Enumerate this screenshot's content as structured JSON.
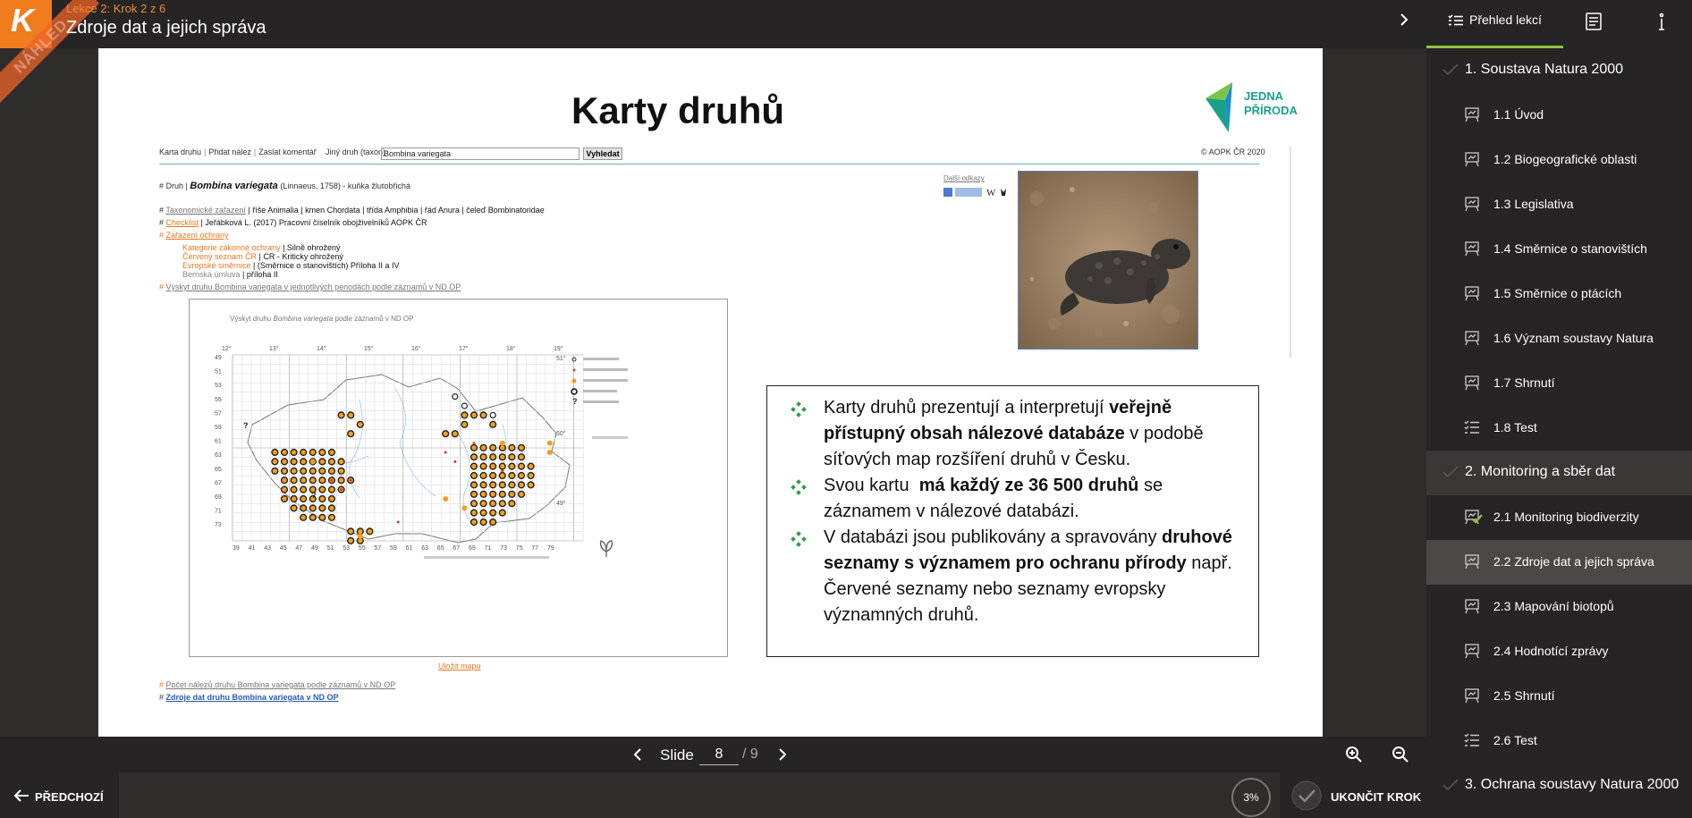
{
  "header": {
    "crumb": "Lekce 2: Krok 2 z 6",
    "title": "Zdroje dat a jejich správa",
    "logo_letter": "K",
    "ribbon": "NÁHLED"
  },
  "sidebar": {
    "tab_overview": "Přehled lekcí",
    "accent": "#8cc63f",
    "sections": [
      {
        "label": "1. Soustava Natura 2000",
        "items": [
          {
            "label": "1.1 Úvod",
            "icon": "slide-icon"
          },
          {
            "label": "1.2 Biogeografické oblasti",
            "icon": "slide-icon"
          },
          {
            "label": "1.3 Legislativa",
            "icon": "slide-icon"
          },
          {
            "label": "1.4 Směrnice o stanovištích",
            "icon": "slide-icon"
          },
          {
            "label": "1.5 Směrnice o ptácích",
            "icon": "slide-icon"
          },
          {
            "label": "1.6 Význam soustavy Natura",
            "icon": "slide-icon"
          },
          {
            "label": "1.7 Shrnutí",
            "icon": "slide-icon"
          },
          {
            "label": "1.8 Test",
            "icon": "test-icon"
          }
        ]
      },
      {
        "label": "2. Monitoring a sběr dat",
        "items": [
          {
            "label": "2.1 Monitoring biodiverzity",
            "icon": "slide-icon",
            "done": true
          },
          {
            "label": "2.2 Zdroje dat a jejich správa",
            "icon": "slide-icon",
            "active": true
          },
          {
            "label": "2.3 Mapování biotopů",
            "icon": "slide-icon"
          },
          {
            "label": "2.4 Hodnotící zprávy",
            "icon": "slide-icon"
          },
          {
            "label": "2.5 Shrnutí",
            "icon": "slide-icon"
          },
          {
            "label": "2.6 Test",
            "icon": "test-icon"
          }
        ]
      },
      {
        "label": "3. Ochrana soustavy Natura 2000",
        "items": []
      }
    ]
  },
  "slide": {
    "title": "Karty druhů",
    "brand_line1": "JEDNA",
    "brand_line2": "PŘÍRODA",
    "webpage": {
      "nav": [
        "Karta druhu",
        "Přidat nález",
        "Zaslat komentář"
      ],
      "search_label": "Jiný druh (taxon)",
      "search_value": "Bombina variegata",
      "search_button": "Vyhledat",
      "copyright": "© AOPK ČR 2020",
      "species_prefix": "# Druh |",
      "species_name": "Bombina variegata",
      "species_author": "(Linnaeus, 1758)",
      "species_common": "- kuňka žlutobřichá",
      "taxonomy_label": "Taxonomické zařazení",
      "taxonomy": "| říše Animalia | kmen Chordata | třída Amphibia | řád Anura | čeleď Bombinatoridae",
      "checklist_label": "Checklist",
      "checklist": "| Jeřábková L. (2017) Pracovní číselník obojživelníků AOPK ČR",
      "protection_label": "Zařazení ochrany",
      "protection": [
        {
          "label": "Kategorie zákonné ochrany",
          "value": "| Silně ohrožený"
        },
        {
          "label": "Červený seznam ČR",
          "value": "| CR - Kriticky ohrožený"
        },
        {
          "label": "Evropské směrnice",
          "value": "| (Směrnice o stanovištích) Příloha II a IV"
        },
        {
          "label": "Bernská úmluva",
          "value": "| příloha II"
        }
      ],
      "occurrence_link": "Výskyt druhu Bombina variegata v jednotlivých periodách podle záznamů v ND OP",
      "more_links": "Další odkazy",
      "map_caption_prefix": "Výskyt druhu",
      "map_caption_species": "Bombina variegata",
      "map_caption_suffix": "podle záznamů v ND OP",
      "save_map": "Uložit mapu",
      "count_link": "Počet nálezů druhu Bombina variegata podle záznamů v ND OP",
      "source_link": "Zdroje dat druhu Bombina variegata v ND OP"
    },
    "bullets": [
      {
        "pre": "Karty druhů prezentují a interpretují ",
        "bold": "veřejně přístupný obsah nálezové databáze",
        "post": " v podobě síťových map rozšíření druhů v Česku."
      },
      {
        "pre": "Svou kartu  ",
        "bold": "má každý ze 36 500 druhů",
        "post": " se záznamem v nálezové databázi."
      },
      {
        "pre": "V databázi jsou publikovány a spravovány ",
        "bold": "druhové seznamy s významem pro ochranu přírody",
        "post": " např. Červené seznamy nebo seznamy evropsky významných druhů."
      }
    ]
  },
  "pager": {
    "label": "Slide",
    "current": "8",
    "total": "/ 9"
  },
  "footer": {
    "prev": "PŘEDCHOZÍ",
    "progress": "3%",
    "end": "UKONČIT KROK"
  }
}
